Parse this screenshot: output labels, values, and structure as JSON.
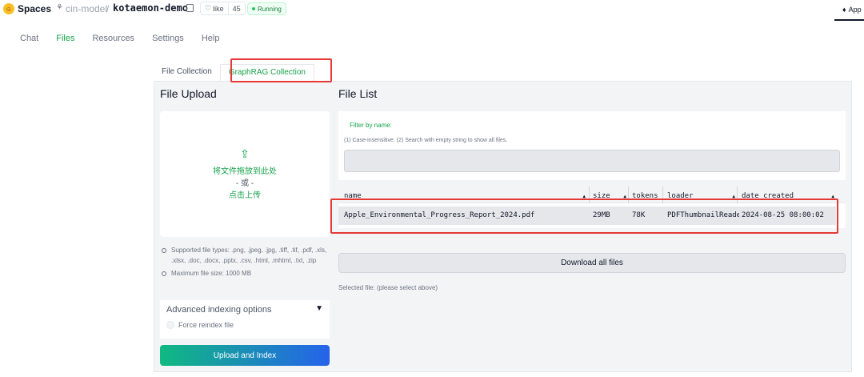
{
  "header": {
    "brand": "Spaces",
    "org": "cin-model",
    "separator": "/",
    "repo": "kotaemon-demo",
    "like_label": "like",
    "like_count": "45",
    "status": "Running",
    "app_tab": "App"
  },
  "nav": {
    "tabs": [
      "Chat",
      "Files",
      "Resources",
      "Settings",
      "Help"
    ],
    "active": "Files"
  },
  "collection_tabs": {
    "file": "File Collection",
    "graphrag": "GraphRAG Collection"
  },
  "upload": {
    "title": "File Upload",
    "drop_text": "将文件拖放到此处",
    "or_text": "- 或 -",
    "click_text": "点击上传",
    "supported_types": "Supported file types: .png, .jpeg, .jpg, .tiff, .tif, .pdf, .xls, .xlsx, .doc, .docx, .pptx, .csv, .html, .mhtml, .txt, .zip",
    "max_size": "Maximum file size: 1000 MB",
    "advanced_label": "Advanced indexing options",
    "reindex_label": "Force reindex file",
    "upload_button": "Upload and Index"
  },
  "file_list": {
    "title": "File List",
    "filter_label": "Filter by name:",
    "filter_help": "(1) Case-insensitive. (2) Search with empty string to show all files.",
    "filter_value": "",
    "columns": [
      "name",
      "size",
      "tokens",
      "loader",
      "date_created"
    ],
    "rows": [
      {
        "name": "Apple_Environmental_Progress_Report_2024.pdf",
        "size": "29MB",
        "tokens": "78K",
        "loader": "PDFThumbnailReader",
        "date_created": "2024-08-25 08:00:02"
      }
    ],
    "download_button": "Download all files",
    "selected_file": "Selected file: (please select above)"
  },
  "colors": {
    "accent_green": "#16a34a",
    "highlight_red": "#e53935",
    "gradient_start": "#10b981",
    "gradient_end": "#2563eb"
  }
}
